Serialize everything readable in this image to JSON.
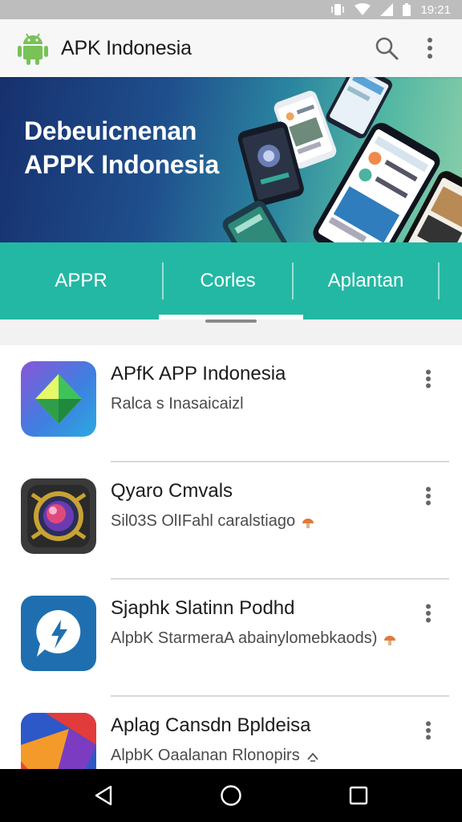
{
  "status_bar": {
    "time": "19:21",
    "icons": [
      "vibrate-icon",
      "wifi-icon",
      "signal-icon",
      "battery-icon"
    ]
  },
  "app_bar": {
    "title": "APK Indonesia",
    "logo": "android-icon",
    "actions": [
      "search-icon",
      "overflow-menu-icon"
    ]
  },
  "banner": {
    "title": "Debeuicnenan APPK Indonesia"
  },
  "tabs": [
    {
      "label": "APPR"
    },
    {
      "label": "Corles"
    },
    {
      "label": "Aplantan"
    }
  ],
  "active_tab_index": 1,
  "apps": [
    {
      "name": "APfK APP Indonesia",
      "subtitle": "Ralca s Inasaicaizl",
      "icon": "diamond-gem-icon",
      "badge": ""
    },
    {
      "name": "Qyaro Cmvals",
      "subtitle": "Sil03S OlIFahl caralstiago",
      "icon": "camera-lens-icon",
      "badge": "mushroom-icon"
    },
    {
      "name": "Sjaphk Slatinn Podhd",
      "subtitle": "AlpbK StarmeraA abainylomebkaods)",
      "icon": "chat-bubble-icon",
      "badge": "mushroom-icon"
    },
    {
      "name": "Aplag Cansdn Bpldeisa",
      "subtitle": "AlpbK Oaalanan Rlonopirs",
      "icon": "colorful-tiles-icon",
      "badge": "up-arrow-icon"
    }
  ],
  "colors": {
    "accent": "#23b8a4",
    "android_green": "#78c257"
  },
  "nav": [
    "back-icon",
    "home-icon",
    "recents-icon"
  ]
}
